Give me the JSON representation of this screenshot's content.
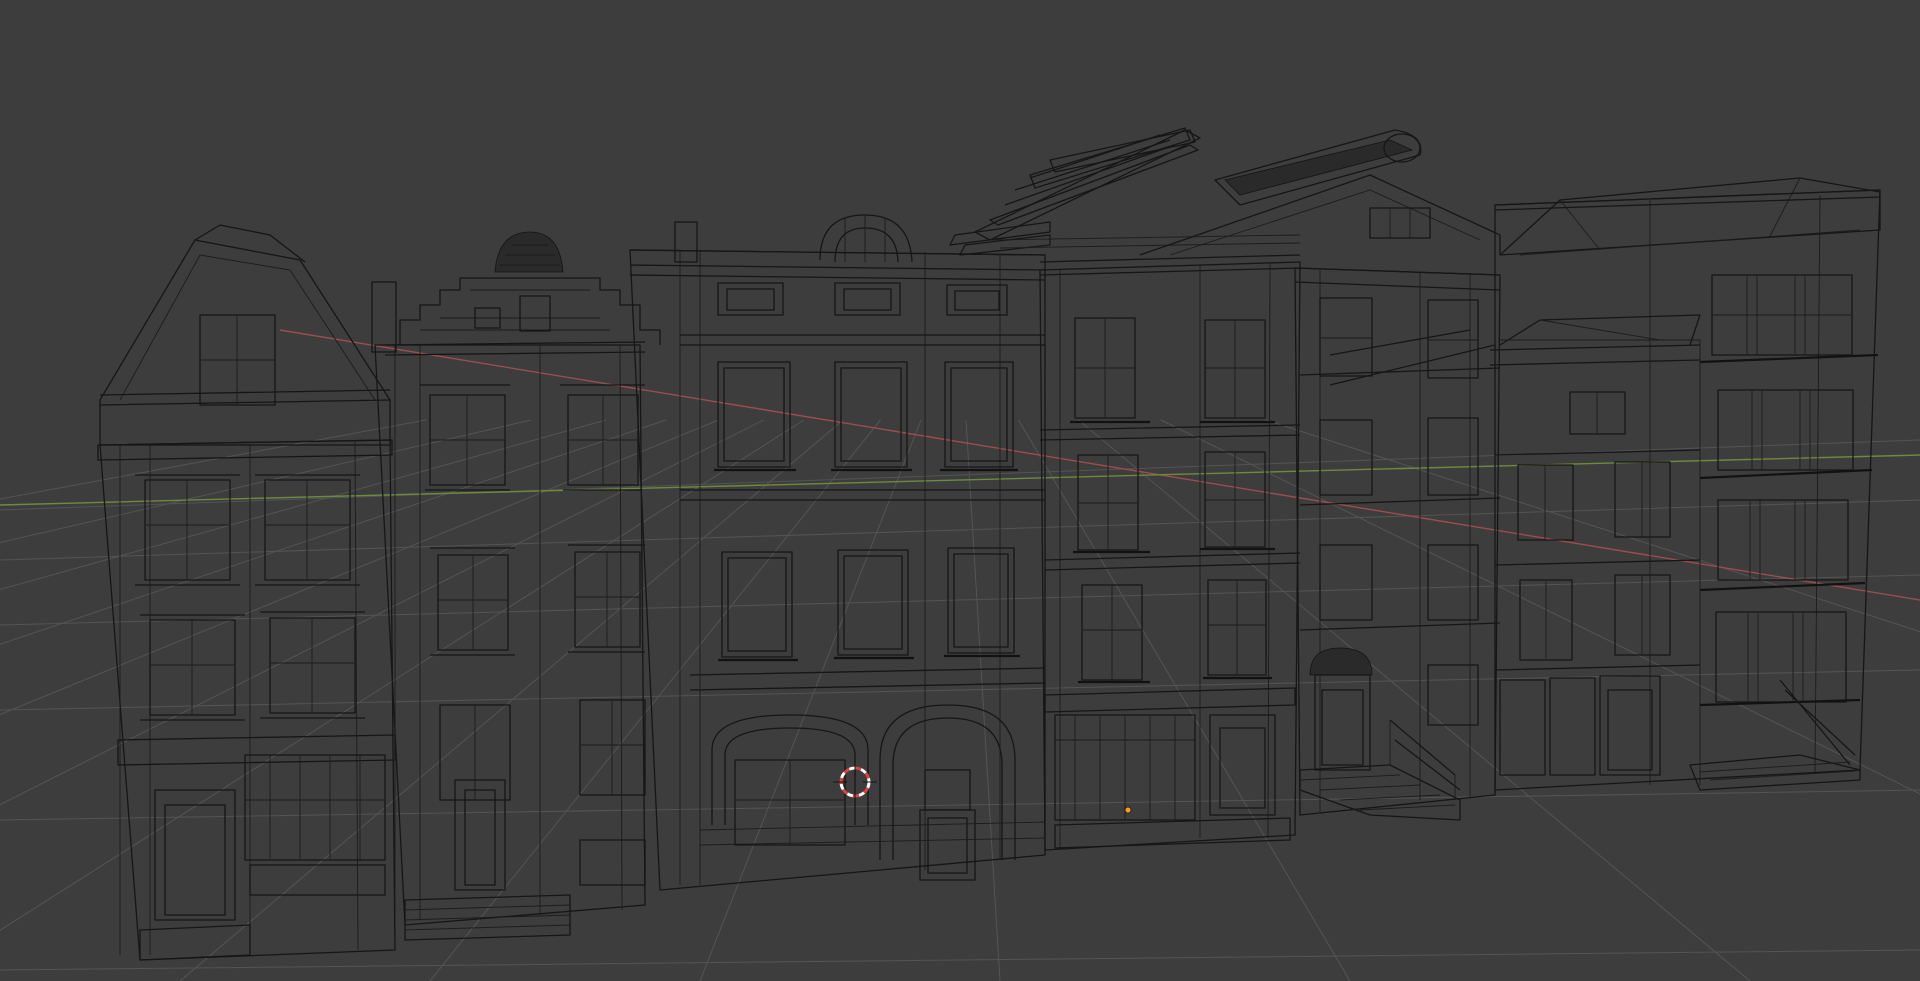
{
  "app": {
    "editor": "3D Viewport",
    "shading_mode": "wireframe"
  },
  "viewport": {
    "colors": {
      "background": "#3d3d3d",
      "grid": "#545454",
      "wire": "#161616",
      "x_axis": "#9b4d4f",
      "y_axis": "#6f8a3f",
      "cursor_red": "#e04040",
      "cursor_white": "#ffffff",
      "origin": "#ff9a1f"
    },
    "icons": {
      "cursor": "3d-cursor-icon",
      "origin": "object-origin-icon"
    },
    "scene": {
      "object": "building-row-facade",
      "building_count": 6
    }
  }
}
